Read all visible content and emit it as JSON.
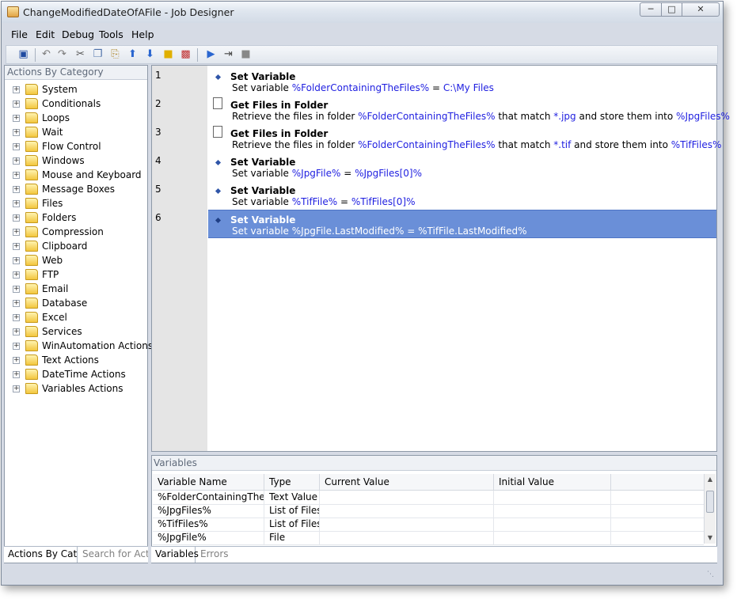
{
  "window": {
    "title": "ChangeModifiedDateOfAFile - Job Designer"
  },
  "menu": [
    "File",
    "Edit",
    "Debug",
    "Tools",
    "Help"
  ],
  "toolbar": {
    "icons": [
      "save-icon",
      "undo-icon",
      "redo-icon",
      "cut-icon",
      "copy-icon",
      "paste-icon",
      "move-up-icon",
      "move-down-icon",
      "note-icon",
      "breakpoint-icon",
      "run-icon",
      "step-icon",
      "stop-icon"
    ]
  },
  "left_panel": {
    "header": "Actions By Category",
    "categories": [
      "System",
      "Conditionals",
      "Loops",
      "Wait",
      "Flow Control",
      "Windows",
      "Mouse and Keyboard",
      "Message Boxes",
      "Files",
      "Folders",
      "Compression",
      "Clipboard",
      "Web",
      "FTP",
      "Email",
      "Database",
      "Excel",
      "Services",
      "WinAutomation Actions",
      "Text Actions",
      "DateTime Actions",
      "Variables Actions"
    ],
    "tabs": [
      "Actions By Cat...",
      "Search for Acti..."
    ]
  },
  "actions": [
    {
      "num": "1",
      "title": "Set Variable",
      "icon": "set-variable-icon",
      "parts": [
        [
          "Set variable ",
          false
        ],
        [
          "%FolderContainingTheFiles%",
          true
        ],
        [
          " = ",
          false
        ],
        [
          "C:\\My Files",
          true
        ]
      ]
    },
    {
      "num": "2",
      "title": "Get Files in Folder",
      "icon": "document-icon",
      "parts": [
        [
          "Retrieve the files in folder ",
          false
        ],
        [
          "%FolderContainingTheFiles%",
          true
        ],
        [
          " that match ",
          false
        ],
        [
          "*.jpg",
          true
        ],
        [
          " and store them into ",
          false
        ],
        [
          "%JpgFiles%",
          true
        ]
      ]
    },
    {
      "num": "3",
      "title": "Get Files in Folder",
      "icon": "document-icon",
      "parts": [
        [
          "Retrieve the files in folder ",
          false
        ],
        [
          "%FolderContainingTheFiles%",
          true
        ],
        [
          " that match ",
          false
        ],
        [
          "*.tif",
          true
        ],
        [
          " and store them into ",
          false
        ],
        [
          "%TifFiles%",
          true
        ]
      ]
    },
    {
      "num": "4",
      "title": "Set Variable",
      "icon": "set-variable-icon",
      "parts": [
        [
          "Set variable ",
          false
        ],
        [
          "%JpgFile%",
          true
        ],
        [
          " = ",
          false
        ],
        [
          "%JpgFiles[0]%",
          true
        ]
      ]
    },
    {
      "num": "5",
      "title": "Set Variable",
      "icon": "set-variable-icon",
      "parts": [
        [
          "Set variable ",
          false
        ],
        [
          "%TifFile%",
          true
        ],
        [
          " = ",
          false
        ],
        [
          "%TifFiles[0]%",
          true
        ]
      ]
    },
    {
      "num": "6",
      "title": "Set Variable",
      "icon": "set-variable-icon",
      "selected": true,
      "parts": [
        [
          "Set variable ",
          false
        ],
        [
          "%JpgFile.LastModified%",
          true
        ],
        [
          " = ",
          false
        ],
        [
          "%TifFile.LastModified%",
          true
        ]
      ]
    }
  ],
  "variables": {
    "header": "Variables",
    "columns": [
      "Variable Name",
      "Type",
      "Current Value",
      "Initial Value"
    ],
    "rows": [
      [
        "%FolderContainingTheFile...",
        "Text Value",
        "",
        ""
      ],
      [
        "%JpgFiles%",
        "List of Files",
        "",
        ""
      ],
      [
        "%TifFiles%",
        "List of Files",
        "",
        ""
      ],
      [
        "%JpgFile%",
        "File",
        "",
        ""
      ]
    ],
    "tabs": [
      "Variables",
      "Errors"
    ]
  },
  "colors": {
    "selection": "#6a8fd8",
    "variable_text": "#1e1ee0"
  }
}
